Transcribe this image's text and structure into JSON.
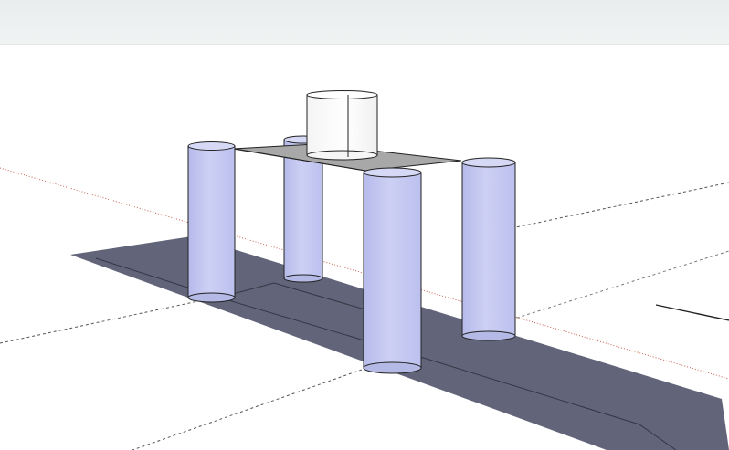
{
  "viewport": {
    "colors": {
      "sky": "#eef1f1",
      "ground": "#ffffff",
      "shadow": "#636679",
      "column_fill": "#c7cbf1",
      "column_top": "#d6d9f5",
      "column_shade": "#b5b9e6",
      "slab": "#a4a4a4",
      "tank": "#ffffff",
      "edge": "#111111",
      "axis_red": "#c24a3a",
      "axis_green": "#3a9a3a",
      "axis_blue": "#3a5ac2"
    }
  }
}
